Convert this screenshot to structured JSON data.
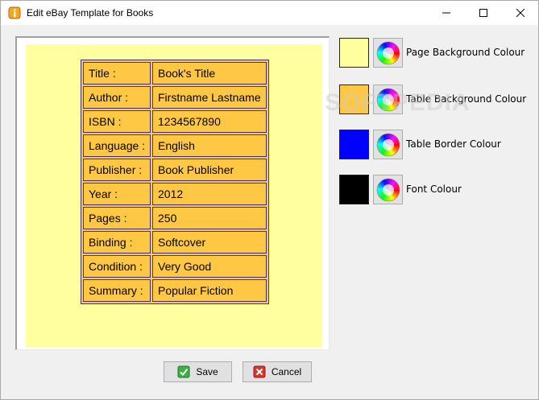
{
  "window": {
    "title": "Edit eBay Template for Books"
  },
  "template": {
    "rows": [
      {
        "label": "Title :",
        "value": "Book's Title"
      },
      {
        "label": "Author :",
        "value": "Firstname Lastname"
      },
      {
        "label": "ISBN :",
        "value": "1234567890"
      },
      {
        "label": "Language :",
        "value": "English"
      },
      {
        "label": "Publisher :",
        "value": "Book Publisher"
      },
      {
        "label": "Year :",
        "value": "2012"
      },
      {
        "label": "Pages :",
        "value": "250"
      },
      {
        "label": "Binding :",
        "value": "Softcover"
      },
      {
        "label": "Condition :",
        "value": "Very Good"
      },
      {
        "label": "Summary :",
        "value": "Popular Fiction"
      }
    ]
  },
  "colours": {
    "page_background": {
      "label": "Page Background Colour",
      "value": "#ffffa0"
    },
    "table_background": {
      "label": "Table Background Colour",
      "value": "#ffc844"
    },
    "table_border": {
      "label": "Table Border Colour",
      "value": "#0000ff"
    },
    "font": {
      "label": "Font Colour",
      "value": "#000000"
    }
  },
  "watermark": "SOFTPEDIA",
  "buttons": {
    "save": "Save",
    "cancel": "Cancel"
  }
}
